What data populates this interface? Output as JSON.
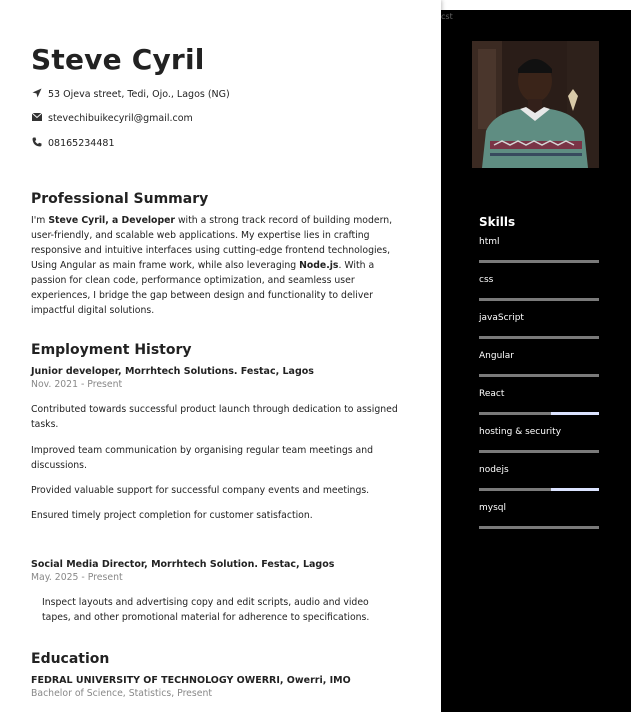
{
  "header": {
    "name": "Steve Cyril",
    "address": "53 Ojeva street, Tedi, Ojo., Lagos (NG)",
    "email": "stevechibuikecyril@gmail.com",
    "phone": "08165234481"
  },
  "summary": {
    "heading": "Professional Summary",
    "intro": "I'm ",
    "name_bold": "Steve Cyril, a Developer",
    "text1": " with a strong track record of building modern, user-friendly, and scalable web applications. My expertise lies in crafting responsive and intuitive interfaces using cutting-edge frontend technologies, Using Angular as main frame work, while also leveraging ",
    "node_bold": "Node.js",
    "text2": ". With a passion for clean code, performance optimization, and seamless user experiences, I bridge the gap between design and functionality to deliver impactful digital solutions."
  },
  "employment": {
    "heading": "Employment History",
    "jobs": [
      {
        "title": "Junior developer, Morrhtech Solutions. Festac, Lagos",
        "date": "Nov. 2021 - Present",
        "bullets": [
          "Contributed towards successful product launch through dedication to assigned tasks.",
          "Improved team communication by organising regular team meetings and discussions.",
          "Provided valuable support for successful company events and meetings.",
          "Ensured timely project completion for customer satisfaction."
        ]
      },
      {
        "title": "Social Media Director, Morrhtech Solution. Festac, Lagos",
        "date": "May. 2025 - Present",
        "bullets": [
          "Inspect layouts and advertising copy and edit scripts, audio and video tapes, and other promotional material for adherence to specifications."
        ]
      }
    ]
  },
  "education": {
    "heading": "Education",
    "school": "FEDRAL UNIVERSITY OF TECHNOLOGY OWERRI, Owerri, IMO",
    "degree": "Bachelor of Science, Statistics, Present"
  },
  "sidebar": {
    "top_label": "cst",
    "skills_heading": "Skills",
    "skills": [
      {
        "name": "html",
        "level": 1.0
      },
      {
        "name": "css",
        "level": 1.0
      },
      {
        "name": "javaScript",
        "level": 1.0
      },
      {
        "name": "Angular",
        "level": 1.0
      },
      {
        "name": "React",
        "level": 0.6
      },
      {
        "name": "hosting & security",
        "level": 1.0
      },
      {
        "name": "nodejs",
        "level": 0.6
      },
      {
        "name": "mysql",
        "level": 1.0
      }
    ],
    "colors": {
      "bar": "#7a7a7a",
      "bar_remainder": "#dbe3ff",
      "background": "#000000"
    }
  }
}
